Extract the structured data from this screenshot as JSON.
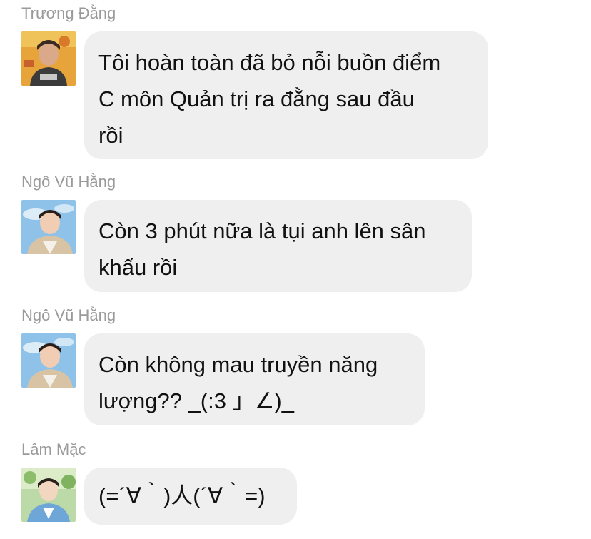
{
  "messages": [
    {
      "sender": "Trương Đằng",
      "avatar": "avatar-orange-bg",
      "text": "Tôi hoàn toàn đã bỏ nỗi buồn điểm\nC môn Quản trị ra đằng sau đầu\nrồi"
    },
    {
      "sender": "Ngô Vũ Hằng",
      "avatar": "avatar-sky-bg",
      "text": "Còn 3 phút nữa là tụi anh lên sân\nkhấu rồi"
    },
    {
      "sender": "Ngô Vũ Hằng",
      "avatar": "avatar-sky-bg",
      "text": "Còn không mau truyền năng\nlượng?? _(:3 」∠)_"
    },
    {
      "sender": "Lâm Mặc",
      "avatar": "avatar-green-bg",
      "text": "(=´∀｀)人(´∀｀=)"
    }
  ],
  "colors": {
    "bubble": "#efefef",
    "sender": "#9a9a9a",
    "text": "#111111",
    "background": "#ffffff"
  }
}
